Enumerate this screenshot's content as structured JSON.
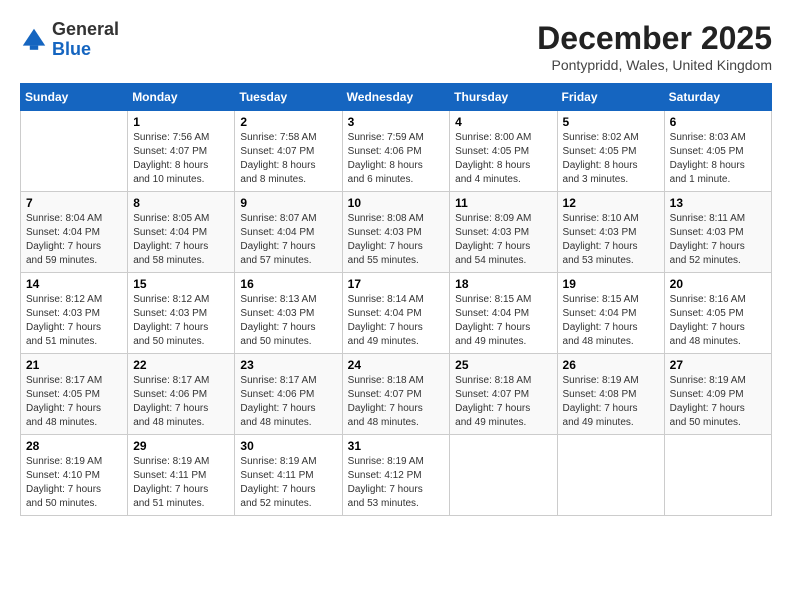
{
  "header": {
    "logo_general": "General",
    "logo_blue": "Blue",
    "month_title": "December 2025",
    "location": "Pontypridd, Wales, United Kingdom"
  },
  "days_of_week": [
    "Sunday",
    "Monday",
    "Tuesday",
    "Wednesday",
    "Thursday",
    "Friday",
    "Saturday"
  ],
  "weeks": [
    [
      {
        "day": "",
        "info": ""
      },
      {
        "day": "1",
        "info": "Sunrise: 7:56 AM\nSunset: 4:07 PM\nDaylight: 8 hours\nand 10 minutes."
      },
      {
        "day": "2",
        "info": "Sunrise: 7:58 AM\nSunset: 4:07 PM\nDaylight: 8 hours\nand 8 minutes."
      },
      {
        "day": "3",
        "info": "Sunrise: 7:59 AM\nSunset: 4:06 PM\nDaylight: 8 hours\nand 6 minutes."
      },
      {
        "day": "4",
        "info": "Sunrise: 8:00 AM\nSunset: 4:05 PM\nDaylight: 8 hours\nand 4 minutes."
      },
      {
        "day": "5",
        "info": "Sunrise: 8:02 AM\nSunset: 4:05 PM\nDaylight: 8 hours\nand 3 minutes."
      },
      {
        "day": "6",
        "info": "Sunrise: 8:03 AM\nSunset: 4:05 PM\nDaylight: 8 hours\nand 1 minute."
      }
    ],
    [
      {
        "day": "7",
        "info": "Sunrise: 8:04 AM\nSunset: 4:04 PM\nDaylight: 7 hours\nand 59 minutes."
      },
      {
        "day": "8",
        "info": "Sunrise: 8:05 AM\nSunset: 4:04 PM\nDaylight: 7 hours\nand 58 minutes."
      },
      {
        "day": "9",
        "info": "Sunrise: 8:07 AM\nSunset: 4:04 PM\nDaylight: 7 hours\nand 57 minutes."
      },
      {
        "day": "10",
        "info": "Sunrise: 8:08 AM\nSunset: 4:03 PM\nDaylight: 7 hours\nand 55 minutes."
      },
      {
        "day": "11",
        "info": "Sunrise: 8:09 AM\nSunset: 4:03 PM\nDaylight: 7 hours\nand 54 minutes."
      },
      {
        "day": "12",
        "info": "Sunrise: 8:10 AM\nSunset: 4:03 PM\nDaylight: 7 hours\nand 53 minutes."
      },
      {
        "day": "13",
        "info": "Sunrise: 8:11 AM\nSunset: 4:03 PM\nDaylight: 7 hours\nand 52 minutes."
      }
    ],
    [
      {
        "day": "14",
        "info": "Sunrise: 8:12 AM\nSunset: 4:03 PM\nDaylight: 7 hours\nand 51 minutes."
      },
      {
        "day": "15",
        "info": "Sunrise: 8:12 AM\nSunset: 4:03 PM\nDaylight: 7 hours\nand 50 minutes."
      },
      {
        "day": "16",
        "info": "Sunrise: 8:13 AM\nSunset: 4:03 PM\nDaylight: 7 hours\nand 50 minutes."
      },
      {
        "day": "17",
        "info": "Sunrise: 8:14 AM\nSunset: 4:04 PM\nDaylight: 7 hours\nand 49 minutes."
      },
      {
        "day": "18",
        "info": "Sunrise: 8:15 AM\nSunset: 4:04 PM\nDaylight: 7 hours\nand 49 minutes."
      },
      {
        "day": "19",
        "info": "Sunrise: 8:15 AM\nSunset: 4:04 PM\nDaylight: 7 hours\nand 48 minutes."
      },
      {
        "day": "20",
        "info": "Sunrise: 8:16 AM\nSunset: 4:05 PM\nDaylight: 7 hours\nand 48 minutes."
      }
    ],
    [
      {
        "day": "21",
        "info": "Sunrise: 8:17 AM\nSunset: 4:05 PM\nDaylight: 7 hours\nand 48 minutes."
      },
      {
        "day": "22",
        "info": "Sunrise: 8:17 AM\nSunset: 4:06 PM\nDaylight: 7 hours\nand 48 minutes."
      },
      {
        "day": "23",
        "info": "Sunrise: 8:17 AM\nSunset: 4:06 PM\nDaylight: 7 hours\nand 48 minutes."
      },
      {
        "day": "24",
        "info": "Sunrise: 8:18 AM\nSunset: 4:07 PM\nDaylight: 7 hours\nand 48 minutes."
      },
      {
        "day": "25",
        "info": "Sunrise: 8:18 AM\nSunset: 4:07 PM\nDaylight: 7 hours\nand 49 minutes."
      },
      {
        "day": "26",
        "info": "Sunrise: 8:19 AM\nSunset: 4:08 PM\nDaylight: 7 hours\nand 49 minutes."
      },
      {
        "day": "27",
        "info": "Sunrise: 8:19 AM\nSunset: 4:09 PM\nDaylight: 7 hours\nand 50 minutes."
      }
    ],
    [
      {
        "day": "28",
        "info": "Sunrise: 8:19 AM\nSunset: 4:10 PM\nDaylight: 7 hours\nand 50 minutes."
      },
      {
        "day": "29",
        "info": "Sunrise: 8:19 AM\nSunset: 4:11 PM\nDaylight: 7 hours\nand 51 minutes."
      },
      {
        "day": "30",
        "info": "Sunrise: 8:19 AM\nSunset: 4:11 PM\nDaylight: 7 hours\nand 52 minutes."
      },
      {
        "day": "31",
        "info": "Sunrise: 8:19 AM\nSunset: 4:12 PM\nDaylight: 7 hours\nand 53 minutes."
      },
      {
        "day": "",
        "info": ""
      },
      {
        "day": "",
        "info": ""
      },
      {
        "day": "",
        "info": ""
      }
    ]
  ]
}
